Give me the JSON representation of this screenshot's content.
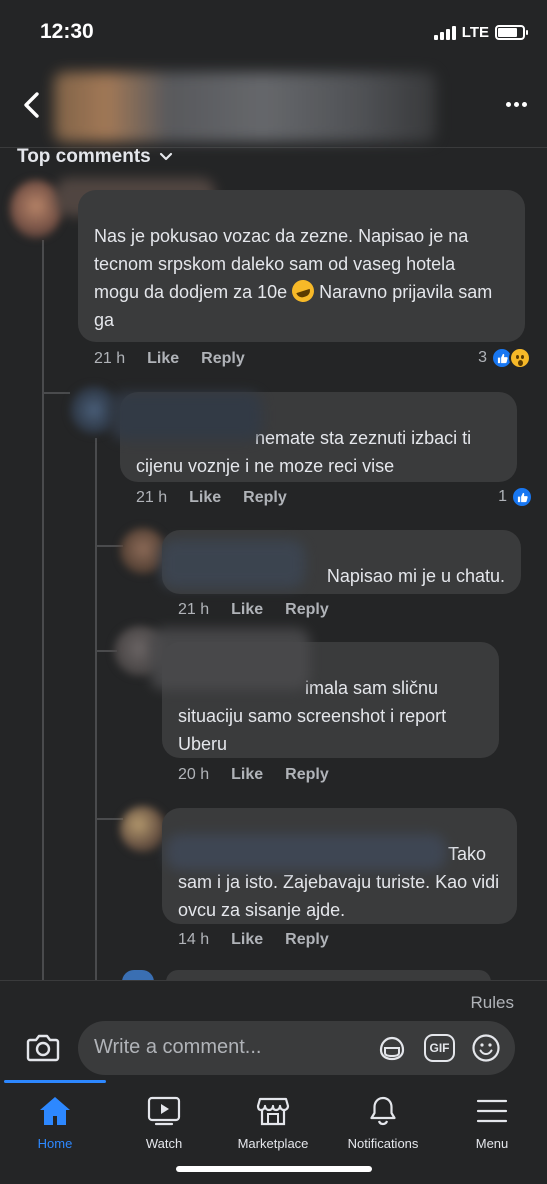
{
  "status_bar": {
    "time": "12:30",
    "network": "LTE"
  },
  "header": {
    "back": "back",
    "more": "more"
  },
  "section": {
    "sort_label": "Top comments"
  },
  "comments": [
    {
      "text_before_emoji": "Nas je pokusao vozac da zezne. Napisao je na tecnom srpskom daleko sam od vaseg hotela mogu da dodjem za 10e",
      "text_after_emoji": " Naravno prijavila sam ga",
      "time": "21 h",
      "like": "Like",
      "reply": "Reply",
      "reaction_count": "3"
    },
    {
      "text": "nemate sta zeznuti izbaci ti cijenu voznje i ne moze reci vise",
      "time": "21 h",
      "like": "Like",
      "reply": "Reply",
      "reaction_count": "1"
    },
    {
      "text": "Napisao mi je u chatu.",
      "time": "21 h",
      "like": "Like",
      "reply": "Reply"
    },
    {
      "text": "imala sam sličnu situaciju samo screenshot i report Uberu",
      "time": "20 h",
      "like": "Like",
      "reply": "Reply"
    },
    {
      "text": "Tako sam i ja isto. Zajebavaju turiste. Kao vidi ovcu za sisanje ajde.",
      "time": "14 h",
      "like": "Like",
      "reply": "Reply"
    }
  ],
  "composer": {
    "rules": "Rules",
    "placeholder": "Write a comment...",
    "gif": "GIF"
  },
  "tabs": [
    {
      "label": "Home",
      "icon": "home-icon",
      "active": true
    },
    {
      "label": "Watch",
      "icon": "watch-icon"
    },
    {
      "label": "Marketplace",
      "icon": "marketplace-icon"
    },
    {
      "label": "Notifications",
      "icon": "bell-icon"
    },
    {
      "label": "Menu",
      "icon": "menu-icon"
    }
  ],
  "colors": {
    "background": "#242526",
    "bubble": "#3a3b3c",
    "accent": "#2d88ff",
    "like_blue": "#1877f2",
    "muted": "#b0b3b8"
  }
}
